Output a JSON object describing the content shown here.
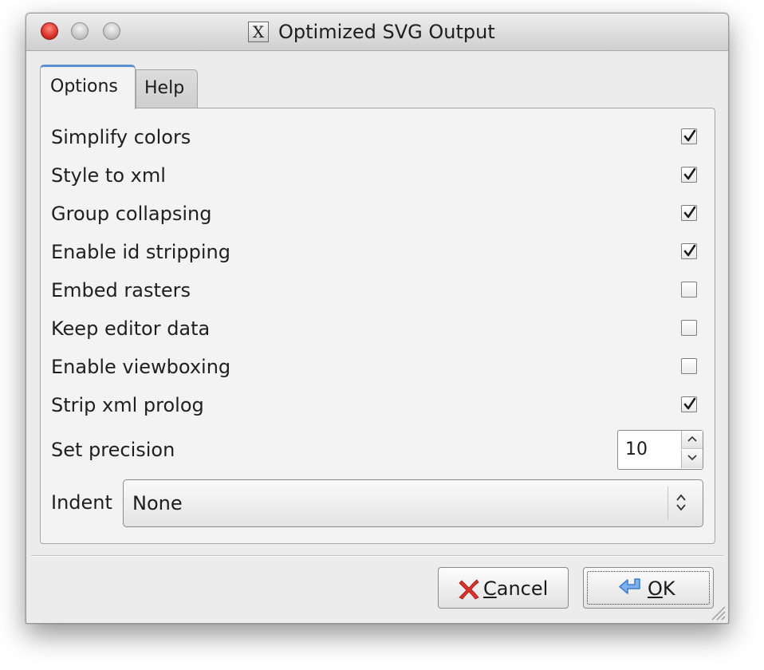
{
  "window": {
    "title": "Optimized SVG Output",
    "app_icon_glyph": "X"
  },
  "tabs": [
    {
      "label": "Options",
      "active": true
    },
    {
      "label": "Help",
      "active": false
    }
  ],
  "options": [
    {
      "label": "Simplify colors",
      "checked": true
    },
    {
      "label": "Style to xml",
      "checked": true
    },
    {
      "label": "Group collapsing",
      "checked": true
    },
    {
      "label": "Enable id stripping",
      "checked": true
    },
    {
      "label": "Embed rasters",
      "checked": false
    },
    {
      "label": "Keep editor data",
      "checked": false
    },
    {
      "label": "Enable viewboxing",
      "checked": false
    },
    {
      "label": "Strip xml prolog",
      "checked": true
    }
  ],
  "precision": {
    "label": "Set precision",
    "value": "10"
  },
  "indent": {
    "label": "Indent",
    "value": "None"
  },
  "buttons": {
    "cancel": {
      "mnemonic": "C",
      "rest": "ancel"
    },
    "ok": {
      "mnemonic": "O",
      "rest": "K"
    }
  },
  "colors": {
    "tab_accent": "#5a8fd6",
    "close_button": "#d8322b",
    "cancel_icon": "#d9322b",
    "ok_icon": "#3f7fcf"
  }
}
